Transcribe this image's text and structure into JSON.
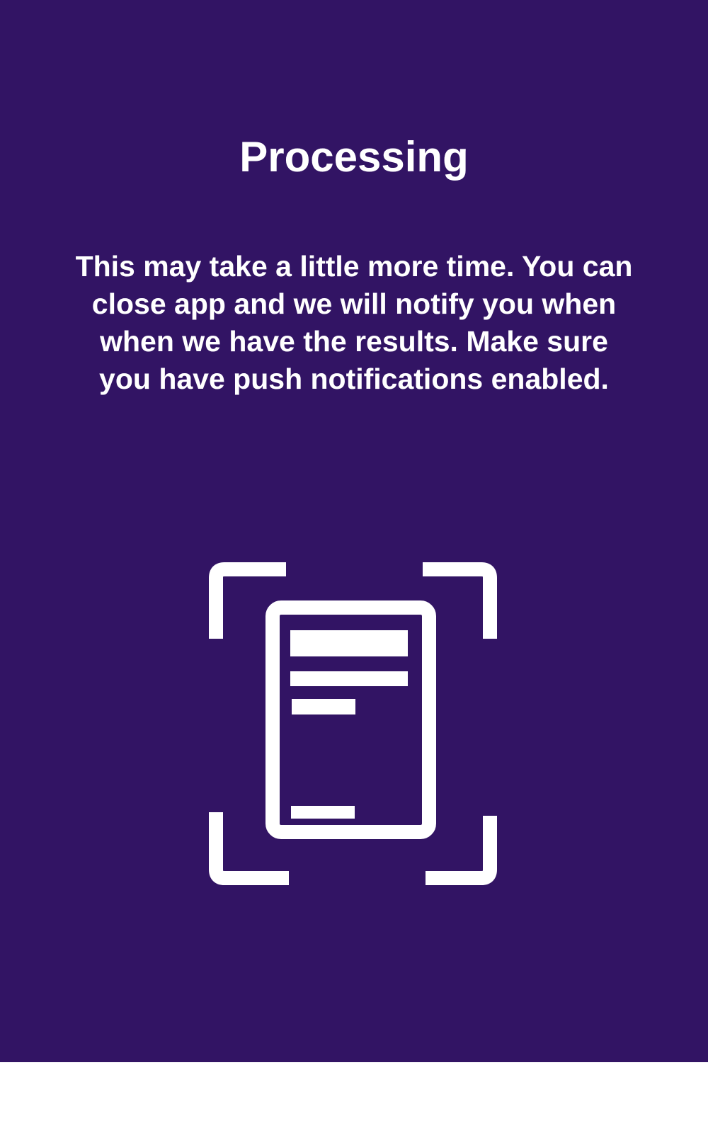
{
  "screen": {
    "title": "Processing",
    "message": "This may take a little more time. You can close app and we will notify you when when we have the results. Make sure you have push notifications enabled.",
    "background_color": "#321464",
    "foreground_color": "#ffffff"
  },
  "illustration": {
    "icon": "document-scan-icon"
  }
}
